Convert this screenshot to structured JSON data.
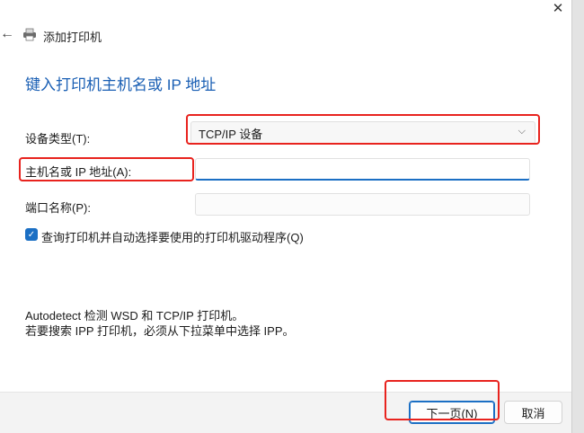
{
  "window": {
    "title": "添加打印机",
    "close_glyph": "✕",
    "back_glyph": "←"
  },
  "page": {
    "heading": "键入打印机主机名或 IP 地址"
  },
  "form": {
    "device_type_label": "设备类型(T):",
    "device_type_value": "TCP/IP 设备",
    "hostname_label": "主机名或 IP 地址(A):",
    "hostname_value": "",
    "port_label": "端口名称(P):",
    "port_value": "",
    "query_checkbox_label": "查询打印机并自动选择要使用的打印机驱动程序(Q)",
    "query_checked": true
  },
  "info": {
    "line1": "Autodetect 检测 WSD 和 TCP/IP 打印机。",
    "line2": "若要搜索 IPP 打印机，必须从下拉菜单中选择 IPP。"
  },
  "buttons": {
    "next": "下一页(N)",
    "cancel": "取消"
  },
  "colors": {
    "accent": "#1b6fc4",
    "heading": "#1a5fb4",
    "annotation": "#e8231e"
  }
}
